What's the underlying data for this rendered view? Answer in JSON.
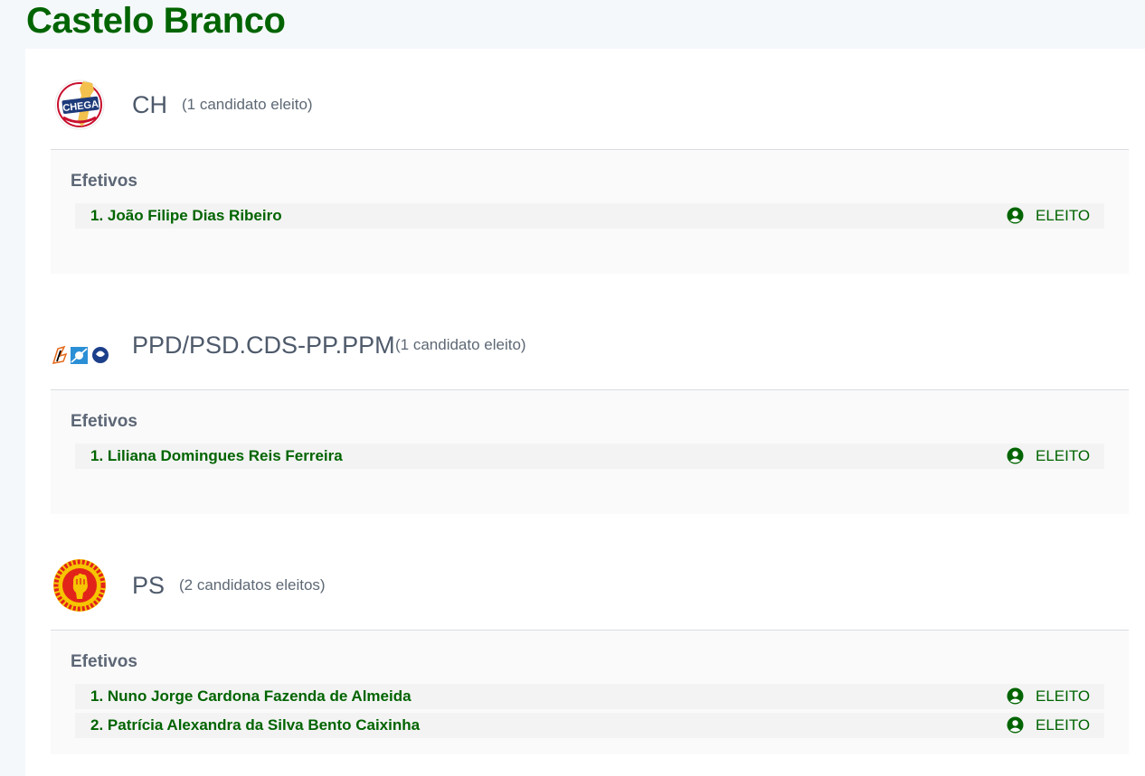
{
  "page": {
    "title": "Castelo Branco"
  },
  "parties": [
    {
      "logo": "chega-logo",
      "name": "CH",
      "count_label": "(1 candidato eleito)",
      "section_label": "Efetivos",
      "candidates": [
        {
          "name": "1. João Filipe Dias Ribeiro",
          "status": "ELEITO",
          "status_icon": "user-circle-icon"
        }
      ]
    },
    {
      "logo": "ppd-psd-cds-ppm-logos",
      "name": "PPD/PSD.CDS-PP.PPM",
      "count_label": "(1 candidato eleito)",
      "section_label": "Efetivos",
      "candidates": [
        {
          "name": "1. Liliana Domingues Reis Ferreira",
          "status": "ELEITO",
          "status_icon": "user-circle-icon"
        }
      ]
    },
    {
      "logo": "ps-logo",
      "name": "PS",
      "count_label": "(2 candidatos eleitos)",
      "section_label": "Efetivos",
      "candidates": [
        {
          "name": "1. Nuno Jorge Cardona Fazenda de Almeida",
          "status": "ELEITO",
          "status_icon": "user-circle-icon"
        },
        {
          "name": "2. Patrícia Alexandra da Silva Bento Caixinha",
          "status": "ELEITO",
          "status_icon": "user-circle-icon"
        }
      ]
    }
  ],
  "colors": {
    "brand_green": "#006400",
    "party_name": "#4e5a6b",
    "panel_bg": "#fafafa"
  }
}
